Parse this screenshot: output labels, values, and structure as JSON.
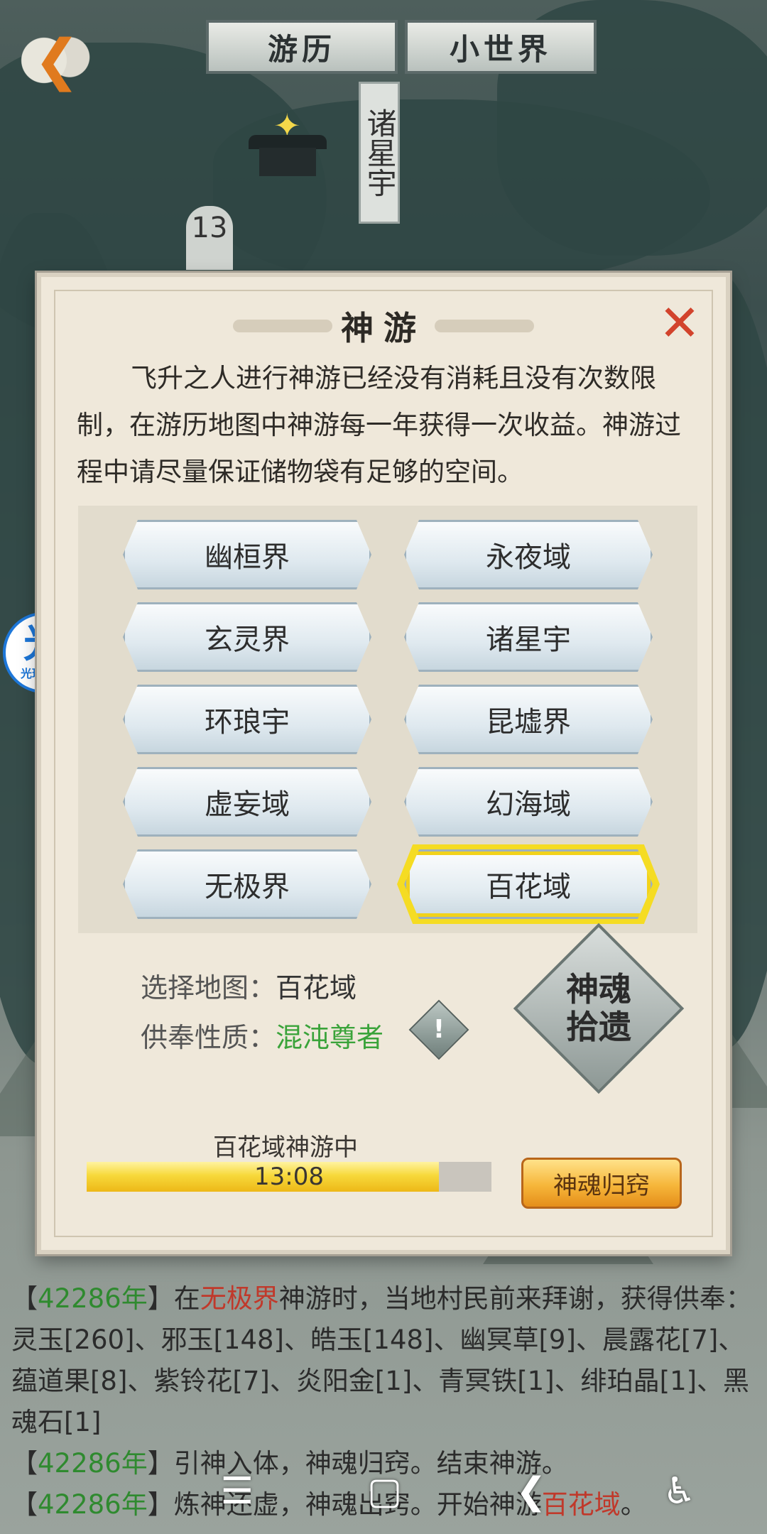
{
  "header": {
    "tabs": [
      "游历",
      "小世界"
    ],
    "current_location": "诸星宇",
    "level_badge": "13"
  },
  "assistant": {
    "glyph": "光",
    "caption": "光环助手"
  },
  "dialog": {
    "title": "神游",
    "description": "飞升之人进行神游已经没有消耗且没有次数限制，在游历地图中神游每一年获得一次收益。神游过程中请尽量保证储物袋有足够的空间。",
    "maps": [
      "幽桓界",
      "永夜域",
      "玄灵界",
      "诸星宇",
      "环琅宇",
      "昆墟界",
      "虚妄域",
      "幻海域",
      "无极界",
      "百花域"
    ],
    "selected_map": "百花域",
    "select_map_label": "选择地图：",
    "select_map_value": "百花域",
    "offering_label": "供奉性质：",
    "offering_value": "混沌尊者",
    "soul_badge_line1": "神魂",
    "soul_badge_line2": "拾遗",
    "progress_label": "百花域神游中",
    "progress_time": "13:08",
    "progress_fraction": 0.87,
    "return_button": "神魂归窍",
    "colors": {
      "selected_outline": "#f5dc23",
      "offering_green": "#3aa33a",
      "close_red": "#d2432c",
      "progress_fill": "#f7d93b",
      "return_orange": "#f6b63a"
    }
  },
  "log": {
    "entries": [
      {
        "open": "【",
        "year": "42286年",
        "close": "】",
        "pre": "在",
        "place": "无极界",
        "post": "神游时，当地村民前来拜谢，获得供奉：灵玉[260]、邪玉[148]、皓玉[148]、幽冥草[9]、晨露花[7]、蕴道果[8]、紫铃花[7]、炎阳金[1]、青冥铁[1]、绯珀晶[1]、黑魂石[1]"
      },
      {
        "open": "【",
        "year": "42286年",
        "close": "】",
        "pre": "引神入体，神魂归窍。结束神游。",
        "place": "",
        "post": ""
      },
      {
        "open": "【",
        "year": "42286年",
        "close": "】",
        "pre": "炼神还虚，神魂出窍。开始神游",
        "place": "百花域",
        "post": "。"
      }
    ],
    "colors": {
      "year": "#2f8a2f",
      "place": "#c0392b"
    }
  },
  "system_nav": {
    "icons": [
      "menu-icon",
      "home-icon",
      "back-icon",
      "accessibility-icon"
    ]
  }
}
